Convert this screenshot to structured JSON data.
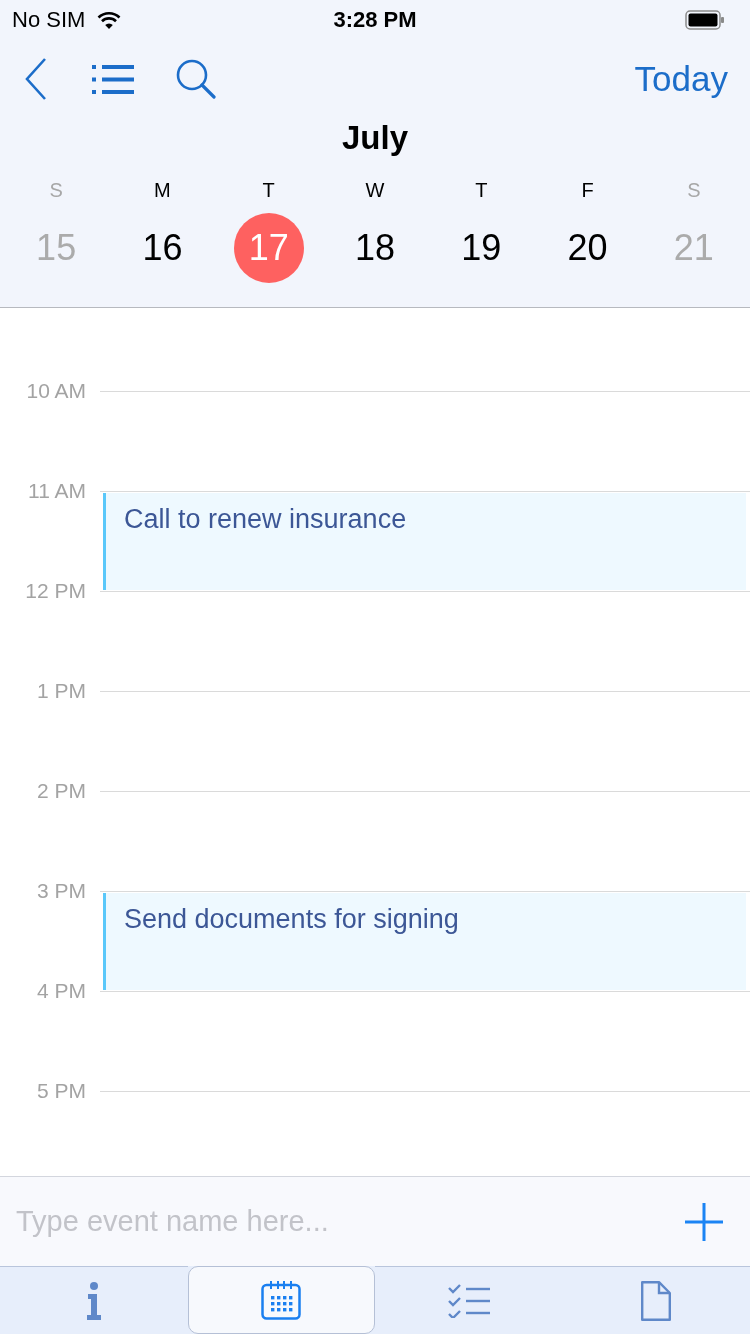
{
  "status_bar": {
    "carrier": "No SIM",
    "time": "3:28 PM"
  },
  "nav": {
    "today_button": "Today"
  },
  "month": "July",
  "days": [
    {
      "weekday": "S",
      "date": "15",
      "weekend": true,
      "selected": false
    },
    {
      "weekday": "M",
      "date": "16",
      "weekend": false,
      "selected": false
    },
    {
      "weekday": "T",
      "date": "17",
      "weekend": false,
      "selected": true
    },
    {
      "weekday": "W",
      "date": "18",
      "weekend": false,
      "selected": false
    },
    {
      "weekday": "T",
      "date": "19",
      "weekend": false,
      "selected": false
    },
    {
      "weekday": "F",
      "date": "20",
      "weekend": false,
      "selected": false
    },
    {
      "weekday": "S",
      "date": "21",
      "weekend": true,
      "selected": false
    }
  ],
  "hours": [
    {
      "label": "10 AM"
    },
    {
      "label": "11 AM",
      "event": {
        "title": "Call to renew insurance"
      }
    },
    {
      "label": "12 PM"
    },
    {
      "label": "1 PM"
    },
    {
      "label": "2 PM"
    },
    {
      "label": "3 PM",
      "event": {
        "title": "Send documents for signing"
      }
    },
    {
      "label": "4 PM"
    },
    {
      "label": "5 PM"
    }
  ],
  "new_event": {
    "placeholder": "Type event name here..."
  },
  "tab_bar": [
    {
      "kind": "info",
      "selected": false
    },
    {
      "kind": "calendar",
      "selected": true
    },
    {
      "kind": "checklist",
      "selected": false
    },
    {
      "kind": "document",
      "selected": false
    }
  ]
}
